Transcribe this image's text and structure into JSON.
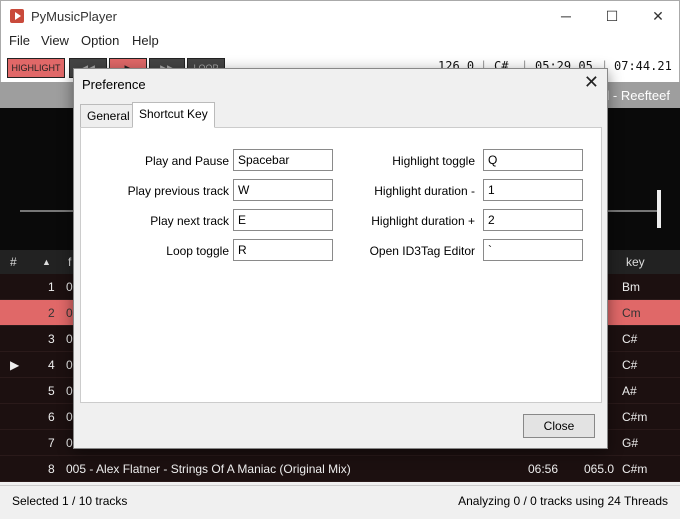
{
  "window": {
    "title": "PyMusicPlayer",
    "minimize": "─",
    "maximize": "☐",
    "close": "✕"
  },
  "menu": [
    "File",
    "View",
    "Option",
    "Help"
  ],
  "toolbar": {
    "highlight": "HIGHLIGHT",
    "prev": "◀◀",
    "play": "▶",
    "next": "▶▶",
    "loop": "LOOP",
    "bpm": "126.0",
    "key": "C#",
    "position": "05:29.05",
    "duration": "07:44.21"
  },
  "now_playing": "d - Reefteef",
  "table": {
    "headers": {
      "num": "#",
      "sort": "▲",
      "title": "f",
      "key": "key"
    },
    "rows": [
      {
        "num": "1",
        "marker": "",
        "title": "00",
        "time": "",
        "bpm": "0",
        "key": "Bm"
      },
      {
        "num": "2",
        "marker": "",
        "title": "00",
        "time": "",
        "bpm": "0",
        "key": "Cm"
      },
      {
        "num": "3",
        "marker": "",
        "title": "00",
        "time": "",
        "bpm": "0",
        "key": "C#"
      },
      {
        "num": "4",
        "marker": "▶",
        "title": "00",
        "time": "",
        "bpm": "0",
        "key": "C#"
      },
      {
        "num": "5",
        "marker": "",
        "title": "00",
        "time": "",
        "bpm": "0",
        "key": "A#"
      },
      {
        "num": "6",
        "marker": "",
        "title": "00",
        "time": "",
        "bpm": "0",
        "key": "C#m"
      },
      {
        "num": "7",
        "marker": "",
        "title": "00",
        "time": "",
        "bpm": "1",
        "key": "G#"
      },
      {
        "num": "8",
        "marker": "",
        "title": "005 - Alex Flatner - Strings Of A Maniac (Original Mix)",
        "time": "06:56",
        "bpm": "065.0",
        "key": "C#m"
      }
    ]
  },
  "status": {
    "left": "Selected 1 / 10 tracks",
    "right": "Analyzing 0 / 0 tracks using 24 Threads"
  },
  "dialog": {
    "title": "Preference",
    "close_icon": "✕",
    "tabs": [
      "General",
      "Shortcut Key"
    ],
    "left_fields": [
      {
        "label": "Play and Pause",
        "value": "Spacebar"
      },
      {
        "label": "Play previous track",
        "value": "W"
      },
      {
        "label": "Play next track",
        "value": "E"
      },
      {
        "label": "Loop toggle",
        "value": "R"
      }
    ],
    "right_fields": [
      {
        "label": "Highlight toggle",
        "value": "Q"
      },
      {
        "label": "Highlight duration -",
        "value": "1"
      },
      {
        "label": "Highlight duration +",
        "value": "2"
      },
      {
        "label": "Open ID3Tag Editor",
        "value": "`"
      }
    ],
    "close_button": "Close"
  }
}
